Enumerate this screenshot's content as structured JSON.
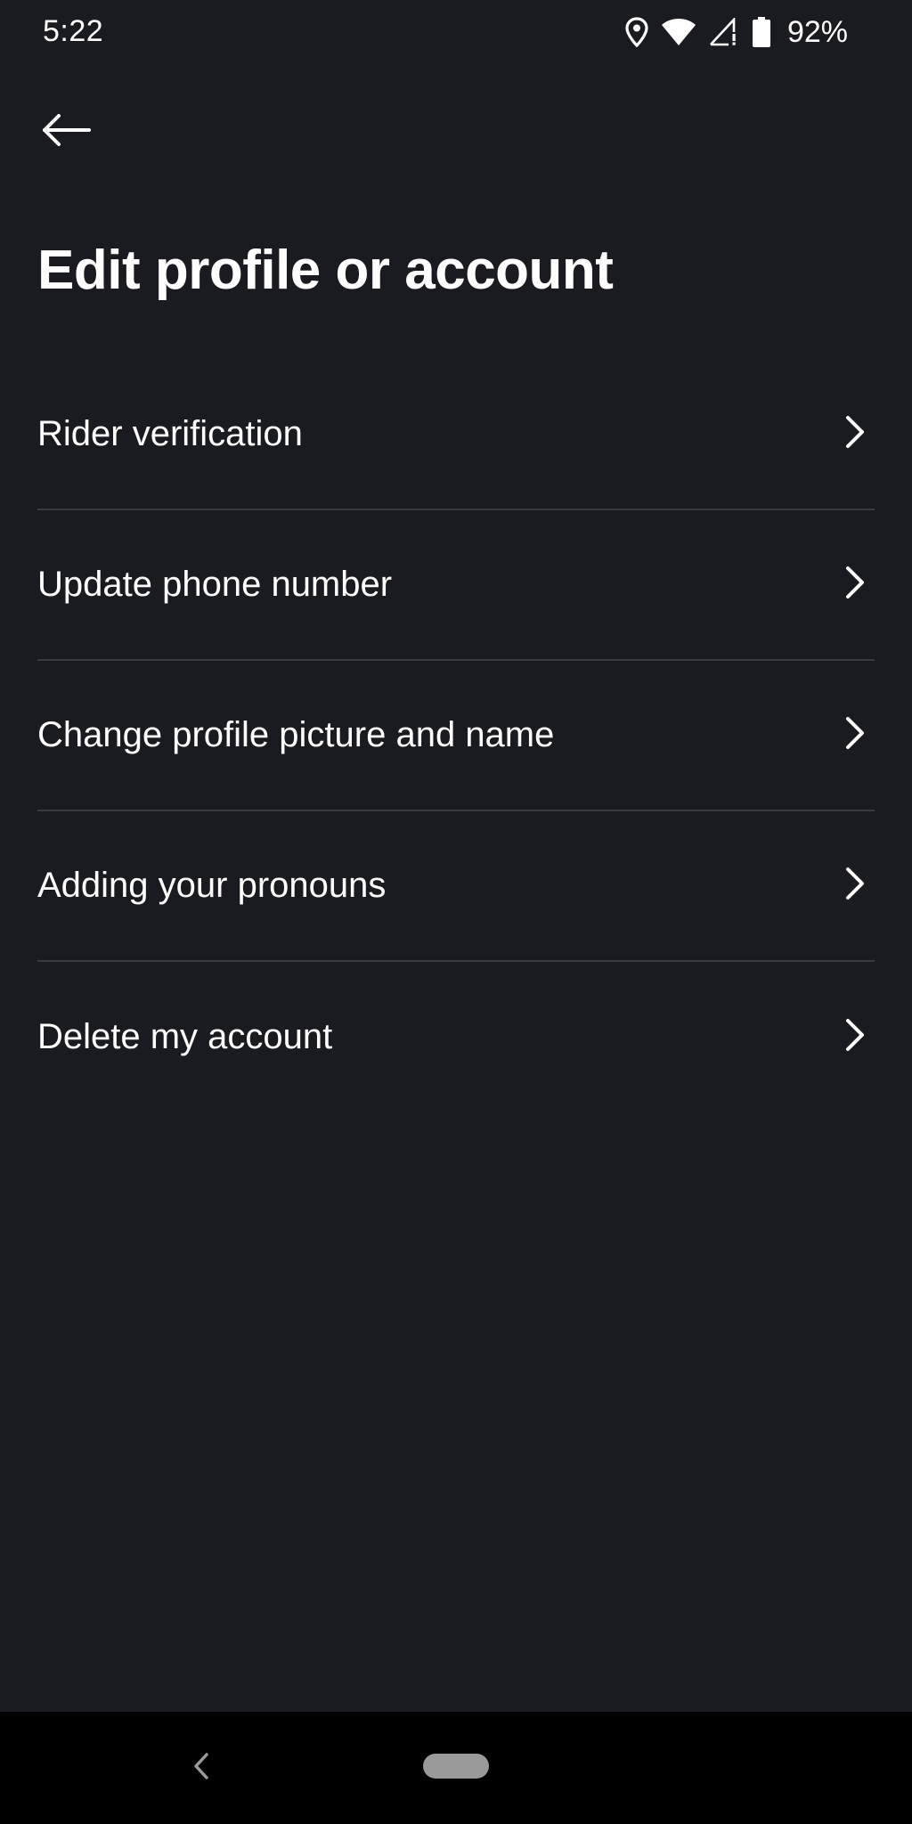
{
  "status_bar": {
    "time": "5:22",
    "battery_percent": "92%",
    "icons": [
      "location-icon",
      "wifi-icon",
      "cellular-signal-icon",
      "battery-icon"
    ]
  },
  "header": {
    "back_icon": "arrow-left-icon",
    "title": "Edit profile or account"
  },
  "menu": {
    "items": [
      {
        "label": "Rider verification",
        "icon": "chevron-right-icon"
      },
      {
        "label": "Update phone number",
        "icon": "chevron-right-icon"
      },
      {
        "label": "Change profile picture and name",
        "icon": "chevron-right-icon"
      },
      {
        "label": "Adding your pronouns",
        "icon": "chevron-right-icon"
      },
      {
        "label": "Delete my account",
        "icon": "chevron-right-icon"
      }
    ]
  },
  "nav_bar": {
    "back_icon": "nav-back-icon",
    "home_icon": "home-pill-icon"
  },
  "colors": {
    "background": "#1a1b21",
    "text": "#ffffff",
    "divider": "#3a3b42",
    "nav_bar": "#000000"
  }
}
